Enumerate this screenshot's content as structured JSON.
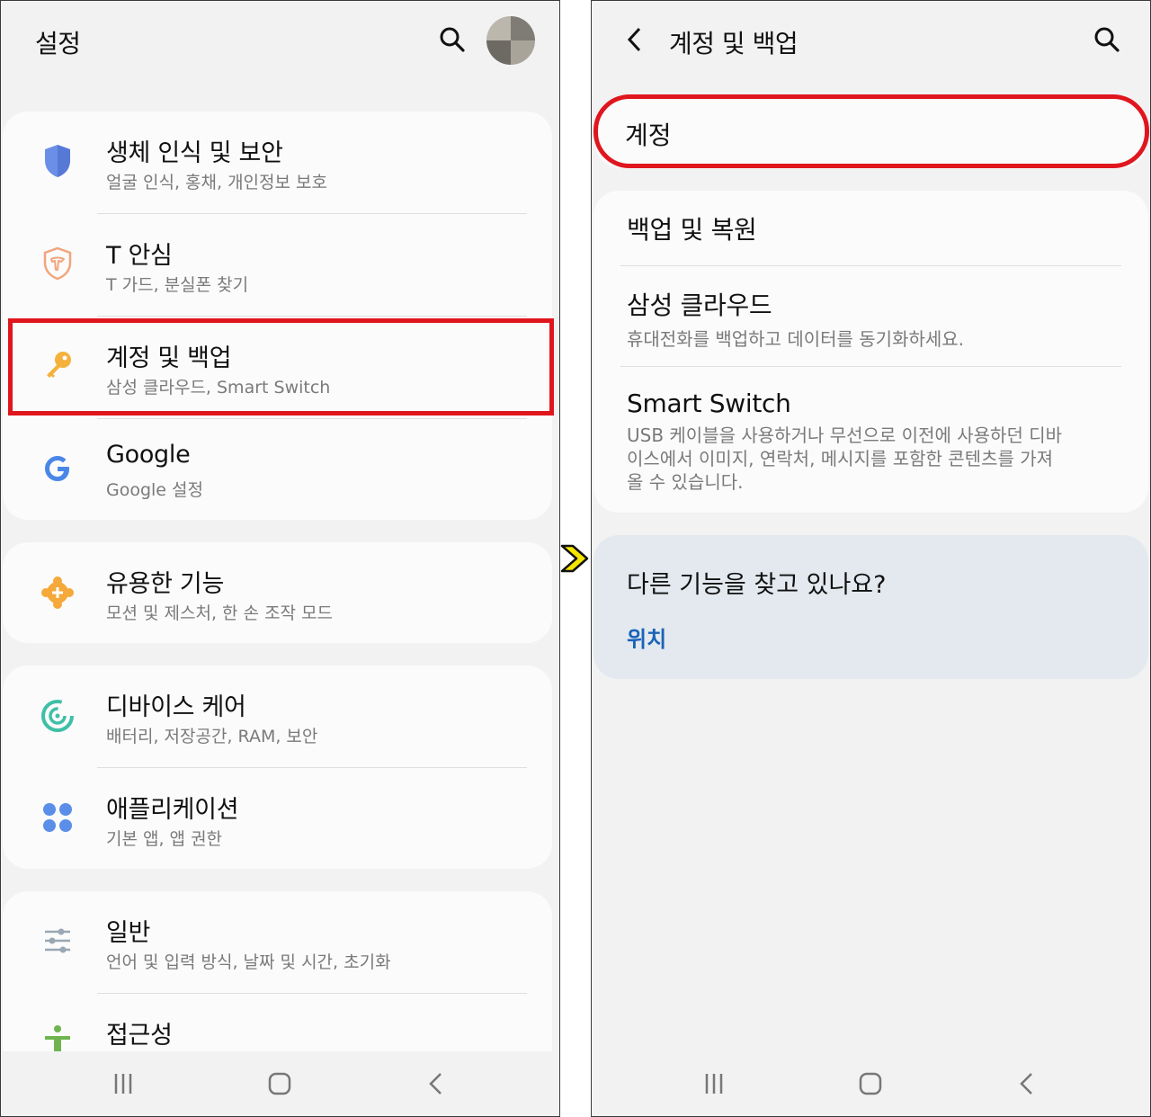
{
  "left": {
    "title": "설정",
    "sections": [
      {
        "items": [
          {
            "title": "생체 인식 및 보안",
            "subtitle": "얼굴 인식, 홍채, 개인정보 보호",
            "icon": "shield-icon"
          },
          {
            "title": "T 안심",
            "subtitle": "T 가드, 분실폰 찾기",
            "icon": "t-shield-icon"
          },
          {
            "title": "계정 및 백업",
            "subtitle": "삼성 클라우드, Smart Switch",
            "icon": "key-icon"
          },
          {
            "title": "Google",
            "subtitle": "Google 설정",
            "icon": "google-icon"
          }
        ]
      },
      {
        "items": [
          {
            "title": "유용한 기능",
            "subtitle": "모션 및 제스처, 한 손 조작 모드",
            "icon": "puzzle-plus-icon"
          }
        ]
      },
      {
        "items": [
          {
            "title": "디바이스 케어",
            "subtitle": "배터리, 저장공간, RAM, 보안",
            "icon": "device-care-icon"
          },
          {
            "title": "애플리케이션",
            "subtitle": "기본 앱, 앱 권한",
            "icon": "apps-grid-icon"
          }
        ]
      },
      {
        "items": [
          {
            "title": "일반",
            "subtitle": "언어 및 입력 방식, 날짜 및 시간, 초기화",
            "icon": "sliders-icon"
          },
          {
            "title": "접근성",
            "subtitle": "",
            "icon": "accessibility-icon"
          }
        ]
      }
    ]
  },
  "right": {
    "title": "계정 및 백업",
    "account_label": "계정",
    "items": [
      {
        "title": "백업 및 복원",
        "subtitle": ""
      },
      {
        "title": "삼성 클라우드",
        "subtitle": "휴대전화를 백업하고 데이터를 동기화하세요."
      },
      {
        "title": "Smart Switch",
        "subtitle": "USB 케이블을 사용하거나 무선으로 이전에 사용하던 디바이스에서 이미지, 연락처, 메시지를 포함한 콘텐츠를 가져올 수 있습니다."
      }
    ],
    "suggest": {
      "title": "다른 기능을 찾고 있나요?",
      "link": "위치"
    }
  },
  "colors": {
    "highlight": "#e0161e",
    "link": "#1a63b8",
    "suggest_bg": "#e3e9ef",
    "arrow": "#f5e600"
  }
}
